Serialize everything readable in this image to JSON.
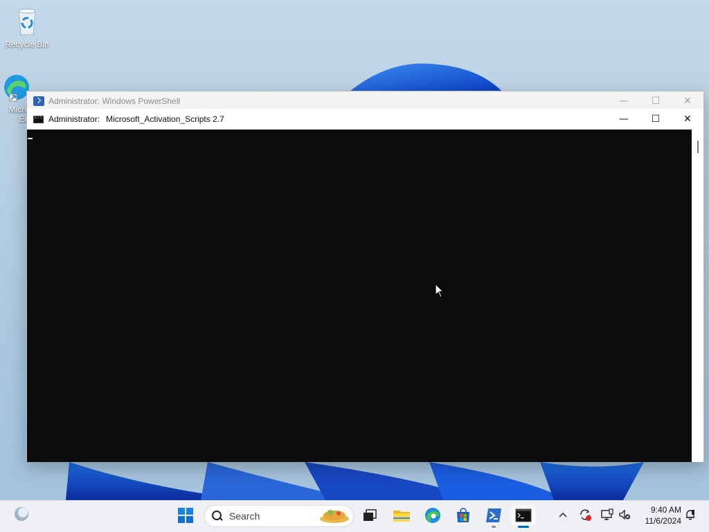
{
  "desktop": {
    "icons": [
      {
        "label": "Recycle Bin",
        "icon": "recycle-bin-icon"
      },
      {
        "label": "Micro\nEd",
        "icon": "microsoft-edge-icon"
      }
    ]
  },
  "windows": {
    "powershell": {
      "title": "Administrator: Windows PowerShell",
      "icon": "powershell-icon",
      "state": "inactive"
    },
    "console": {
      "title_prefix": "Administrator:",
      "title": "Microsoft_Activation_Scripts 2.7",
      "icon": "console-icon",
      "state": "active",
      "background": "#0c0c0c"
    }
  },
  "window_controls": {
    "minimize": "—",
    "maximize": "☐",
    "close": "✕"
  },
  "taskbar": {
    "search_placeholder": "Search",
    "apps": [
      {
        "name": "start",
        "icon": "windows-start-icon"
      },
      {
        "name": "task-view",
        "icon": "task-view-icon"
      },
      {
        "name": "file-explorer",
        "icon": "file-explorer-icon"
      },
      {
        "name": "edge",
        "icon": "microsoft-edge-icon"
      },
      {
        "name": "store",
        "icon": "microsoft-store-icon"
      },
      {
        "name": "powershell",
        "icon": "powershell-icon"
      },
      {
        "name": "terminal",
        "icon": "terminal-icon"
      }
    ],
    "tray": {
      "chevron": "^",
      "time": "9:40 AM",
      "date": "11/6/2024"
    }
  },
  "colors": {
    "accent": "#0067c0",
    "taskbar": "#eef0f3",
    "console_bg": "#0c0c0c"
  }
}
